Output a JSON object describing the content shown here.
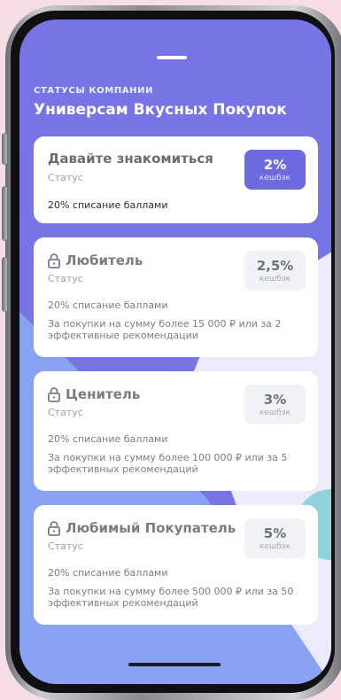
{
  "header": {
    "caption": "СТАТУСЫ КОМПАНИИ",
    "title": "Универсам Вкусных Покупок"
  },
  "colors": {
    "accent": "#6d6ae0",
    "screen_bg": "#7774e6",
    "page_bg": "#f7dde6"
  },
  "statuses": [
    {
      "name": "Давайте знакомиться",
      "subtitle": "Статус",
      "points_note": "20% списание баллами",
      "condition": "",
      "cashback_value": "2%",
      "cashback_label": "кешбэк",
      "active": true,
      "locked": false
    },
    {
      "name": "Любитель",
      "subtitle": "Статус",
      "points_note": "20% списание баллами",
      "condition": "За покупки на сумму более 15 000 ₽ или за 2 эффективные рекомендации",
      "cashback_value": "2,5%",
      "cashback_label": "кешбэк",
      "active": false,
      "locked": true,
      "icon": "lock-icon"
    },
    {
      "name": "Ценитель",
      "subtitle": "Статус",
      "points_note": "20% списание баллами",
      "condition": "За покупки на сумму более 100 000 ₽ или за 5 эффективных рекомендаций",
      "cashback_value": "3%",
      "cashback_label": "кешбэк",
      "active": false,
      "locked": true,
      "icon": "lock-icon"
    },
    {
      "name": "Любимый Покупатель",
      "subtitle": "Статус",
      "points_note": "20% списание баллами",
      "condition": "За покупки на сумму более 500 000 ₽ или за 50 эффективных рекомендаций",
      "cashback_value": "5%",
      "cashback_label": "кешбэк",
      "active": false,
      "locked": true,
      "icon": "lock-icon"
    }
  ]
}
